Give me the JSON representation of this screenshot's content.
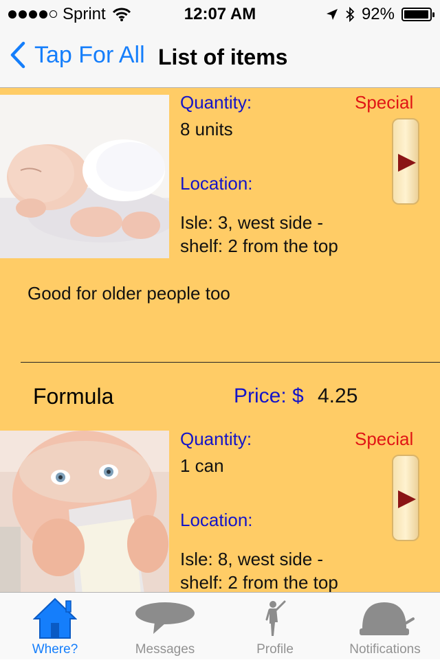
{
  "status_bar": {
    "carrier": "Sprint",
    "time": "12:07 AM",
    "battery": "92%",
    "battery_level": 0.92
  },
  "nav": {
    "back_label": "Tap For All",
    "title": "List of items"
  },
  "items": [
    {
      "image": "baby-sleeping-diaper-photo",
      "quantity_label": "Quantity:",
      "quantity": "8 units",
      "special": "Special",
      "location_label": "Location:",
      "location_line1": "Isle: 3, west side -",
      "location_line2": "shelf: 2 from the top",
      "note": "Good for older people too"
    },
    {
      "name": "Formula",
      "price_label": "Price: $",
      "price": "4.25",
      "image": "baby-drinking-bottle-photo",
      "quantity_label": "Quantity:",
      "quantity": "1 can",
      "special": "Special",
      "location_label": "Location:",
      "location_line1": "Isle: 8, west side -",
      "location_line2": "shelf: 2 from the top"
    }
  ],
  "tabs": [
    {
      "label": "Where?",
      "icon": "house-icon",
      "active": true
    },
    {
      "label": "Messages",
      "icon": "speech-bubble-icon",
      "active": false
    },
    {
      "label": "Profile",
      "icon": "person-icon",
      "active": false
    },
    {
      "label": "Notifications",
      "icon": "bell-icon",
      "active": false
    }
  ],
  "colors": {
    "accent": "#157efb",
    "content_bg": "#ffcc66",
    "label_blue": "#1414c8",
    "special_red": "#e01515"
  }
}
